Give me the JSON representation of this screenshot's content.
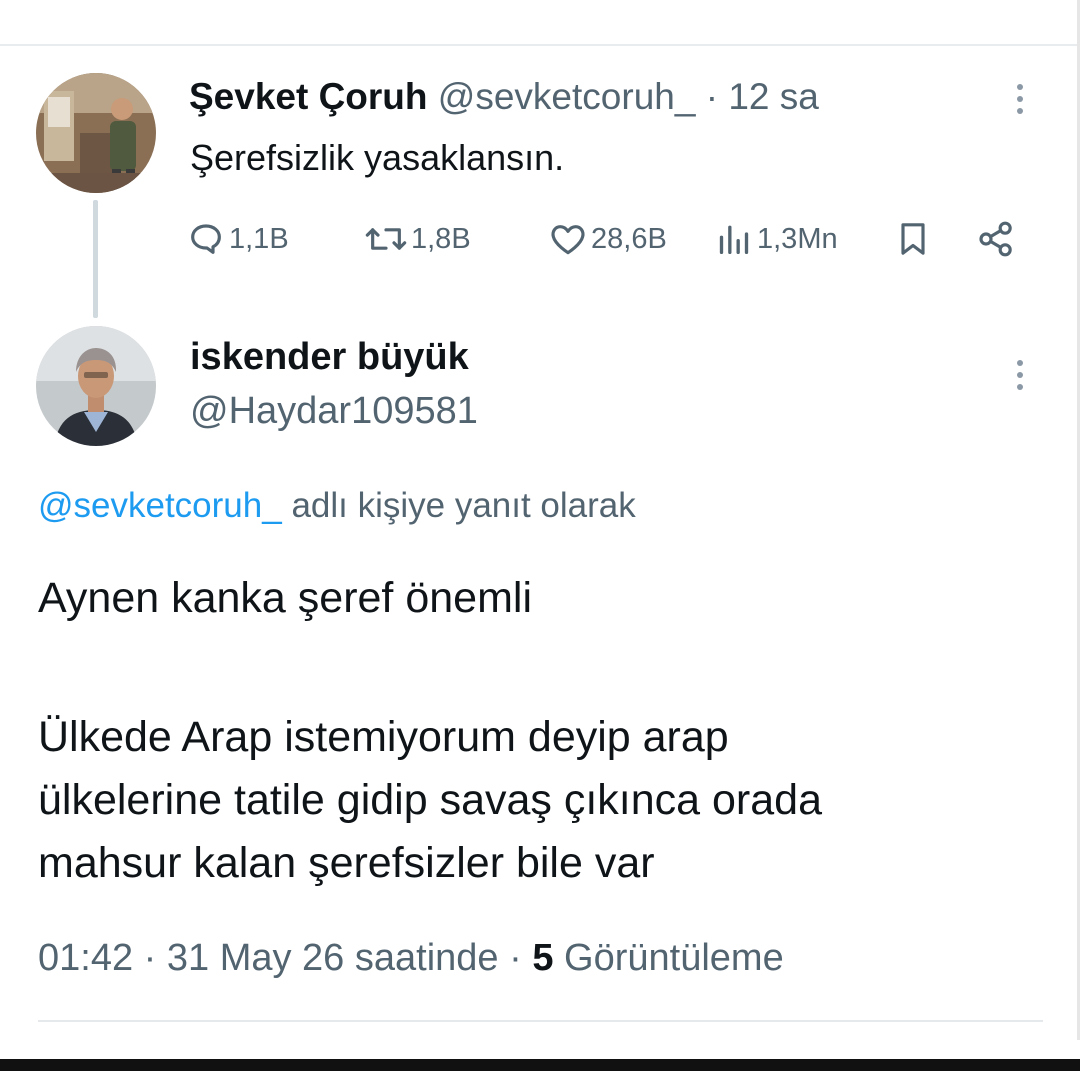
{
  "tweet": {
    "name": "Şevket Çoruh",
    "handle": "@sevketcoruh_",
    "separator": "·",
    "time": "12 sa",
    "text": "Şerefsizlik yasaklansın.",
    "avatar_icon": "user-photo-avatar",
    "actions": {
      "replies": "1,1B",
      "retweets": "1,8B",
      "likes": "28,6B",
      "views": "1,3Mn",
      "reply_icon": "reply-bubble-icon",
      "retweet_icon": "retweet-arrows-icon",
      "like_icon": "heart-icon",
      "views_icon": "bar-chart-icon",
      "bookmark_icon": "bookmark-icon",
      "share_icon": "share-icon"
    }
  },
  "reply": {
    "name": "iskender büyük",
    "handle": "@Haydar109581",
    "avatar_icon": "user-photo-avatar",
    "replying_to_mention": "@sevketcoruh_",
    "replying_to_text": "adlı kişiye yanıt olarak",
    "paragraphs": [
      "Aynen kanka şeref önemli",
      "Ülkede Arap istemiyorum deyip arap\nülkelerine tatile gidip savaş çıkınca orada\nmahsur kalan şerefsizler bile var"
    ],
    "timestamp": "01:42",
    "separator": "·",
    "date": "31 May 26 saatinde",
    "views_count": "5",
    "views_label": "Görüntüleme"
  },
  "colors": {
    "text": "#0f1419",
    "secondary": "#536471",
    "link": "#1d9bf0",
    "thread_line": "#cfd9de"
  }
}
